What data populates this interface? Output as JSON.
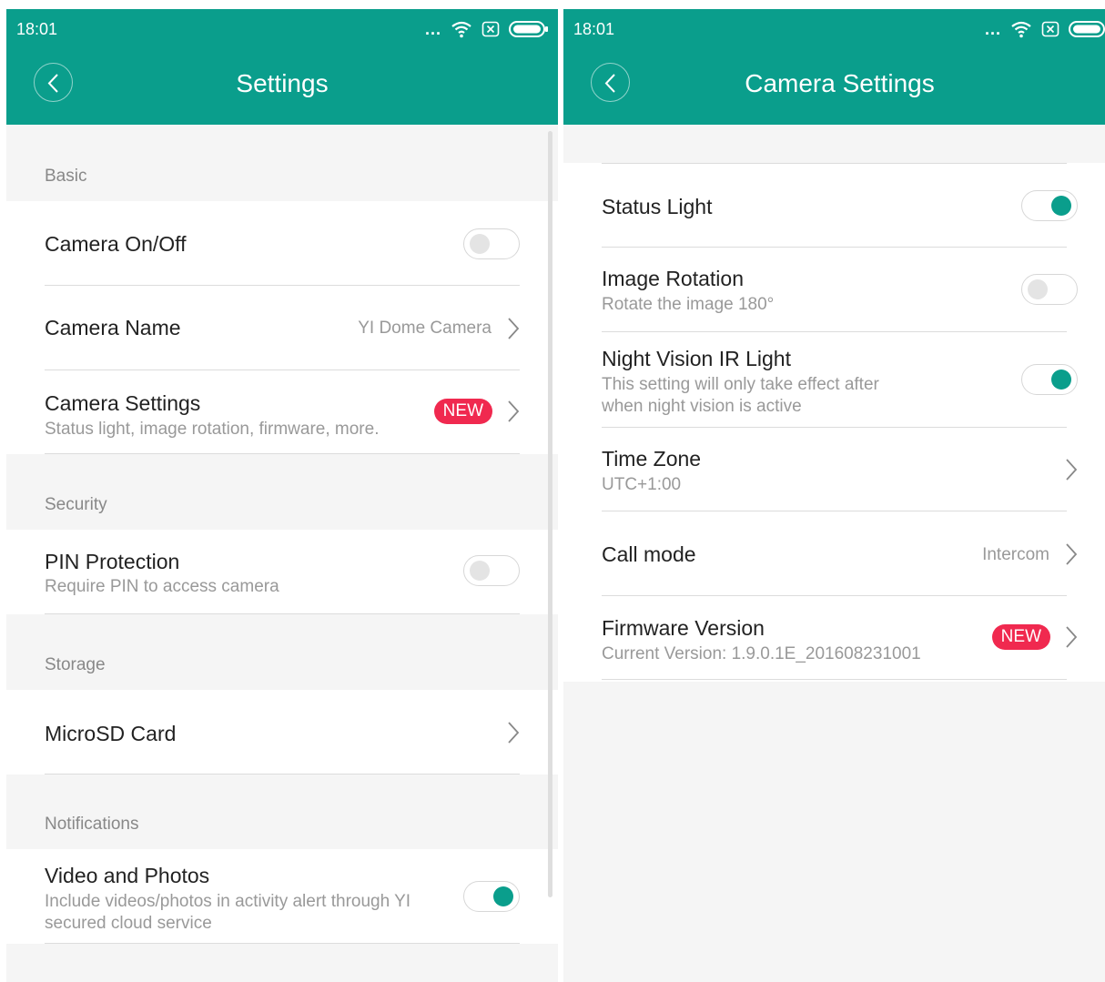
{
  "colors": {
    "accent": "#0a9e8c",
    "badge": "#f0294f"
  },
  "status_bar": {
    "time": "18:01",
    "dots": "...",
    "icons": [
      "wifi-icon",
      "sim-icon",
      "battery-icon"
    ]
  },
  "left": {
    "title": "Settings",
    "sections": {
      "basic": "Basic",
      "security": "Security",
      "storage": "Storage",
      "notifications": "Notifications"
    },
    "camera_onoff": {
      "label": "Camera On/Off",
      "on": false
    },
    "camera_name": {
      "label": "Camera Name",
      "value": "YI Dome Camera"
    },
    "camera_settings": {
      "label": "Camera Settings",
      "sub": "Status light, image rotation, firmware, more.",
      "badge": "NEW"
    },
    "pin": {
      "label": "PIN Protection",
      "sub": "Require PIN to access camera",
      "on": false
    },
    "microsd": {
      "label": "MicroSD Card"
    },
    "video": {
      "label": "Video and Photos",
      "sub1": "Include videos/photos in activity alert through YI",
      "sub2": "secured cloud service",
      "on": true
    }
  },
  "right": {
    "title": "Camera Settings",
    "status_light": {
      "label": "Status Light",
      "on": true
    },
    "image_rotation": {
      "label": "Image Rotation",
      "sub": "Rotate the image 180°",
      "on": false
    },
    "night_vision": {
      "label": "Night Vision IR Light",
      "sub1": "This setting will only take effect after",
      "sub2": "when night vision is active",
      "on": true
    },
    "time_zone": {
      "label": "Time Zone",
      "sub": "UTC+1:00"
    },
    "call_mode": {
      "label": "Call mode",
      "value": "Intercom"
    },
    "firmware": {
      "label": "Firmware Version",
      "sub": "Current Version: 1.9.0.1E_201608231001",
      "badge": "NEW"
    }
  }
}
